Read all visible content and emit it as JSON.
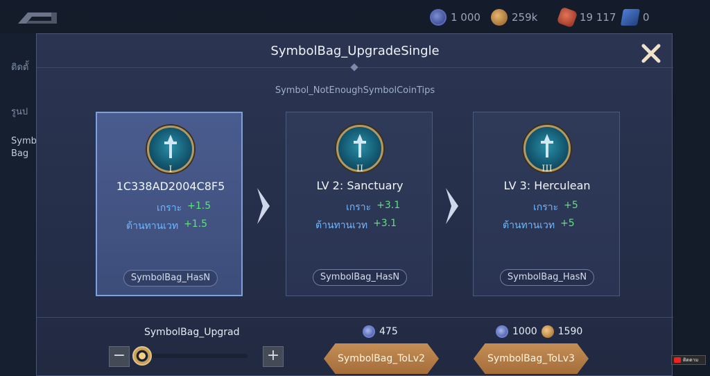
{
  "topbar": {
    "resources": [
      {
        "icon": "symbol-coin-icon",
        "value": "1 000"
      },
      {
        "icon": "gold-coin-icon",
        "value": "259k"
      },
      {
        "icon": "ruby-icon",
        "value": "19 117"
      },
      {
        "icon": "card-icon",
        "value": "0"
      }
    ]
  },
  "side": {
    "items": [
      "ติดตั้",
      "รูนป",
      "Symb",
      "Bag"
    ]
  },
  "dialog": {
    "title": "SymbolBag_UpgradeSingle",
    "tips": "Symbol_NotEnoughSymbolCoinTips",
    "cards": [
      {
        "roman": "I",
        "title": "1C338AD2004C8F5",
        "stats": [
          {
            "label": "เกราะ",
            "value": "+1.5"
          },
          {
            "label": "ต้านทานเวท",
            "value": "+1.5"
          }
        ],
        "has_label": "SymbolBag_HasN"
      },
      {
        "roman": "II",
        "title": "LV 2: Sanctuary",
        "stats": [
          {
            "label": "เกราะ",
            "value": "+3.1"
          },
          {
            "label": "ต้านทานเวท",
            "value": "+3.1"
          }
        ],
        "has_label": "SymbolBag_HasN"
      },
      {
        "roman": "III",
        "title": "LV 3: Herculean",
        "stats": [
          {
            "label": "เกราะ",
            "value": "+5"
          },
          {
            "label": "ต้านทานเวท",
            "value": "+5"
          }
        ],
        "has_label": "SymbolBag_HasN"
      }
    ],
    "upgrade_label": "SymbolBag_Upgrad",
    "cost_lv2": {
      "symbol_coin": "475"
    },
    "cost_lv3": {
      "symbol_coin": "1000",
      "gold": "1590"
    },
    "btn_lv2": "SymbolBag_ToLv2",
    "btn_lv3": "SymbolBag_ToLv3"
  },
  "watermark": {
    "text": "ติดตาม"
  },
  "colors": {
    "stat_label": "#6fb8ff",
    "stat_value": "#5ee37a",
    "button": "#b57b45",
    "selected_card": "#4a5c8e"
  }
}
